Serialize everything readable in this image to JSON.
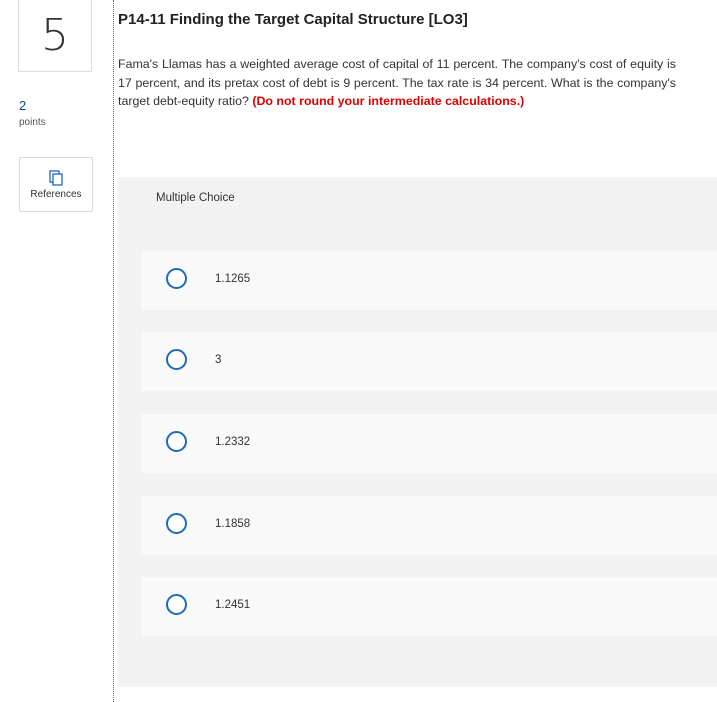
{
  "question": {
    "number": "5",
    "points_value": "2",
    "points_label": "points",
    "references_label": "References",
    "title": "P14-11 Finding the Target Capital Structure [LO3]",
    "body": "Fama's Llamas has a weighted average cost of capital of 11 percent. The company's cost of equity is 17 percent, and its pretax cost of debt is 9 percent. The tax rate is 34 percent. What is the company's target debt-equity ratio?",
    "emphasis": "(Do not round your intermediate calculations.)"
  },
  "multiple_choice": {
    "label": "Multiple Choice",
    "options": [
      {
        "text": "1.1265"
      },
      {
        "text": "3"
      },
      {
        "text": "1.2332"
      },
      {
        "text": "1.1858"
      },
      {
        "text": "1.2451"
      }
    ]
  },
  "colors": {
    "radio_border": "#1f6ab8",
    "emphasis_text": "#e00000",
    "points_value": "#0a4a8f",
    "panel_background": "#f2f2f2",
    "option_background": "#f9f9f9"
  },
  "icons": {
    "references": "document-copy-icon"
  }
}
